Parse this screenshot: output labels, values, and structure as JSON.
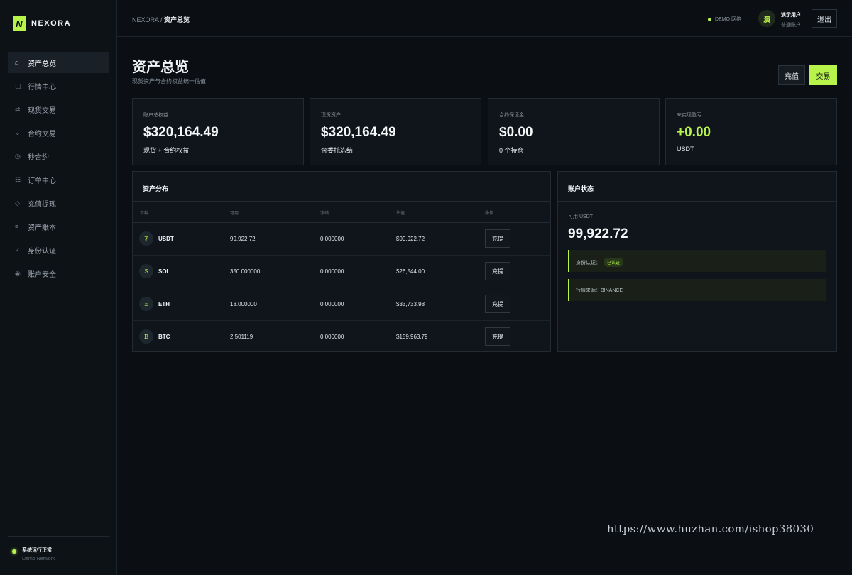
{
  "brand": {
    "mark": "N",
    "name": "NEXORA"
  },
  "sidebar": {
    "items": [
      {
        "icon": "⌂",
        "label": "资产总览"
      },
      {
        "icon": "◫",
        "label": "行情中心"
      },
      {
        "icon": "⇄",
        "label": "现货交易"
      },
      {
        "icon": "⌄",
        "label": "合约交易"
      },
      {
        "icon": "◷",
        "label": "秒合约"
      },
      {
        "icon": "☷",
        "label": "订单中心"
      },
      {
        "icon": "◇",
        "label": "充值提现"
      },
      {
        "icon": "≡",
        "label": "资产账本"
      },
      {
        "icon": "✓",
        "label": "身份认证"
      },
      {
        "icon": "◉",
        "label": "账户安全"
      }
    ],
    "system": {
      "title": "系统运行正常",
      "subtitle": "Demo Network"
    }
  },
  "topbar": {
    "breadcrumb_root": "NEXORA",
    "breadcrumb_sep": " / ",
    "breadcrumb_current": "资产总览",
    "network": "DEMO 网络",
    "avatar_char": "演",
    "user_name": "演示用户",
    "user_role": "普通账户",
    "logout_label": "退出"
  },
  "header": {
    "title": "资产总览",
    "subtitle": "现货资产与合约权益统一估值",
    "recharge_label": "充值",
    "trade_label": "交易"
  },
  "stats": [
    {
      "label": "账户总权益",
      "value": "$320,164.49",
      "sub": "现货 + 合约权益"
    },
    {
      "label": "现货资产",
      "value": "$320,164.49",
      "sub": "含委托冻结"
    },
    {
      "label": "合约保证金",
      "value": "$0.00",
      "sub": "0 个持仓"
    },
    {
      "label": "未实现盈亏",
      "value": "+0.00",
      "sub": "USDT"
    }
  ],
  "assets": {
    "title": "资产分布",
    "columns": [
      "币种",
      "可用",
      "冻结",
      "估值",
      "操作"
    ],
    "rows": [
      {
        "icon": "₮",
        "symbol": "USDT",
        "available": "99,922.72",
        "frozen": "0.000000",
        "value": "$99,922.72",
        "action": "充提"
      },
      {
        "icon": "S",
        "symbol": "SOL",
        "available": "350.000000",
        "frozen": "0.000000",
        "value": "$26,544.00",
        "action": "充提"
      },
      {
        "icon": "Ξ",
        "symbol": "ETH",
        "available": "18.000000",
        "frozen": "0.000000",
        "value": "$33,733.98",
        "action": "充提"
      },
      {
        "icon": "₿",
        "symbol": "BTC",
        "available": "2.501119",
        "frozen": "0.000000",
        "value": "$159,963.79",
        "action": "充提"
      }
    ]
  },
  "account_status": {
    "title": "账户状态",
    "available_label": "可用 USDT",
    "available_value": "99,922.72",
    "kyc_label": "身份认证：",
    "kyc_badge": "已认证",
    "source_label": "行情来源：BINANCE"
  },
  "watermark": "https://www.huzhan.com/ishop38030",
  "colors": {
    "accent": "#b7f34a",
    "background": "#0b0f14",
    "panel": "#0f151b"
  }
}
